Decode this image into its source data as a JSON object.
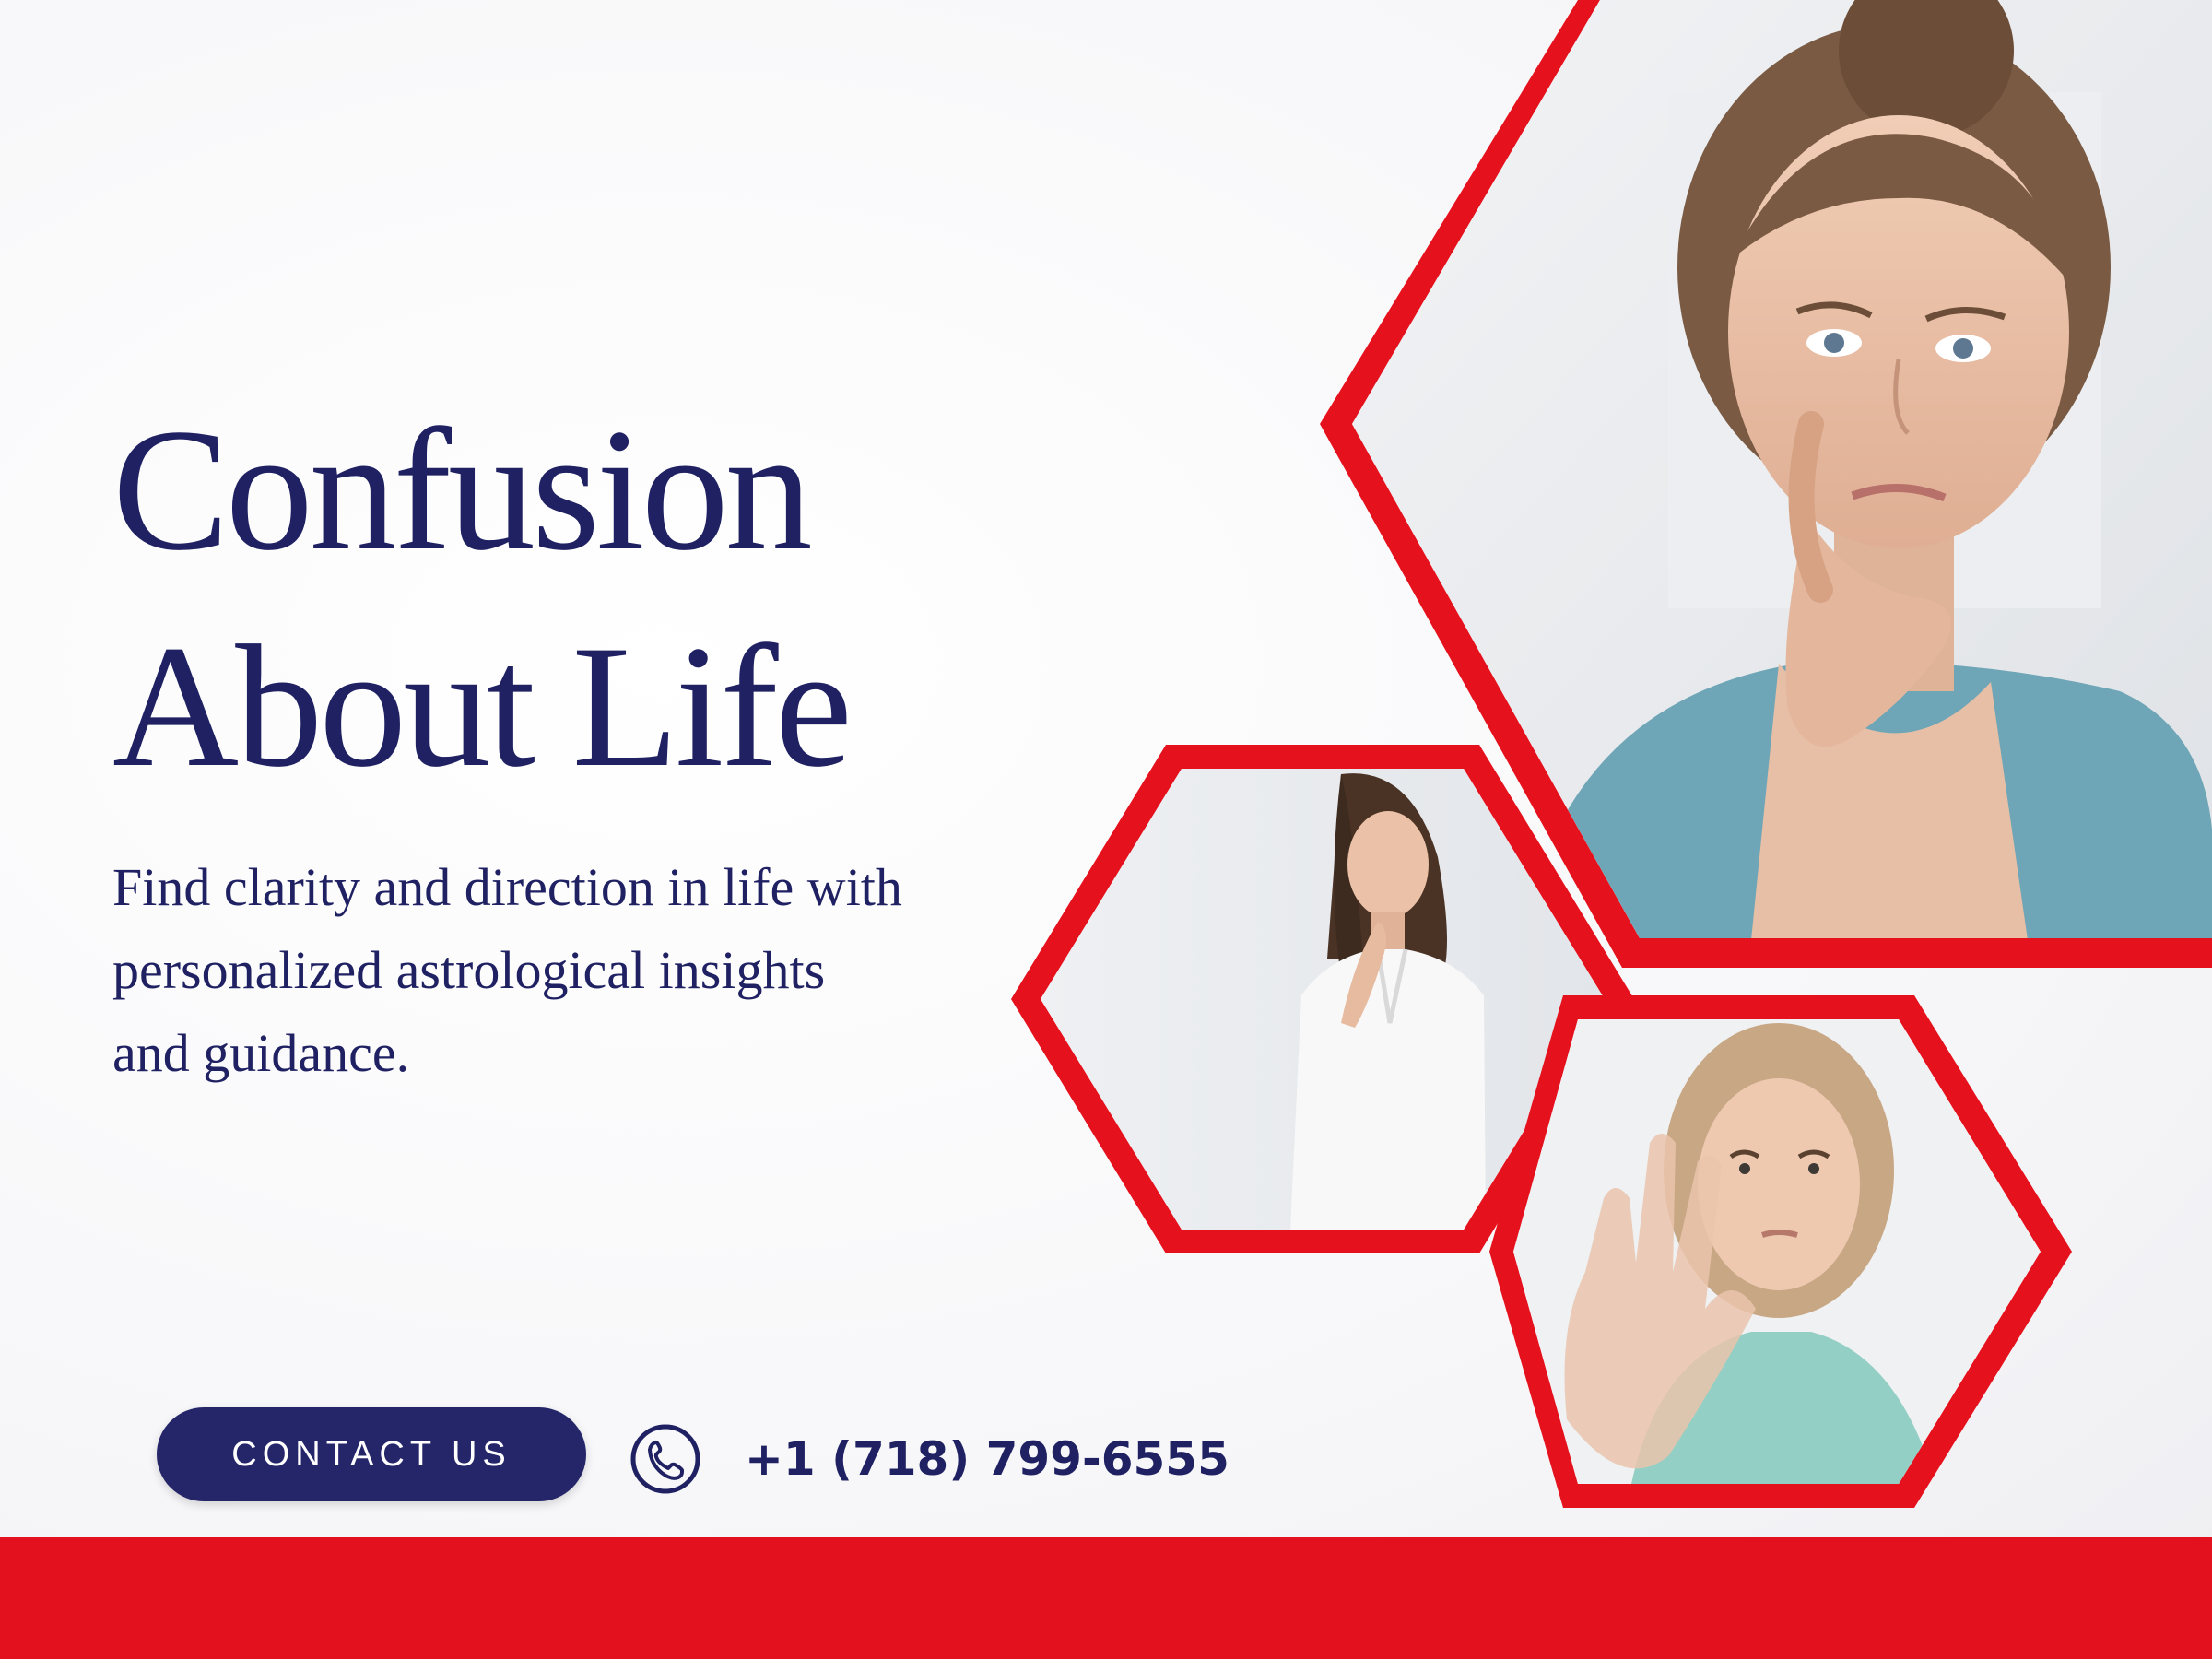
{
  "hero": {
    "title_line1": "Confusion",
    "title_line2": "About Life",
    "subtitle_line1": "Find clarity and direction in life with",
    "subtitle_line2": "personalized astrological insights",
    "subtitle_line3": "and guidance."
  },
  "cta": {
    "contact_label": "CONTACT US",
    "phone": "+1 (718) 799-6555",
    "phone_icon": "phone-icon"
  },
  "colors": {
    "brand_navy": "#1f2162",
    "button_navy": "#242669",
    "accent_red": "#e3101e"
  },
  "images": [
    {
      "name": "woman-thinking-hand-on-chin",
      "shape": "hexagon"
    },
    {
      "name": "woman-in-white-shirt-thinking",
      "shape": "hexagon"
    },
    {
      "name": "woman-stop-gesture",
      "shape": "hexagon"
    }
  ]
}
